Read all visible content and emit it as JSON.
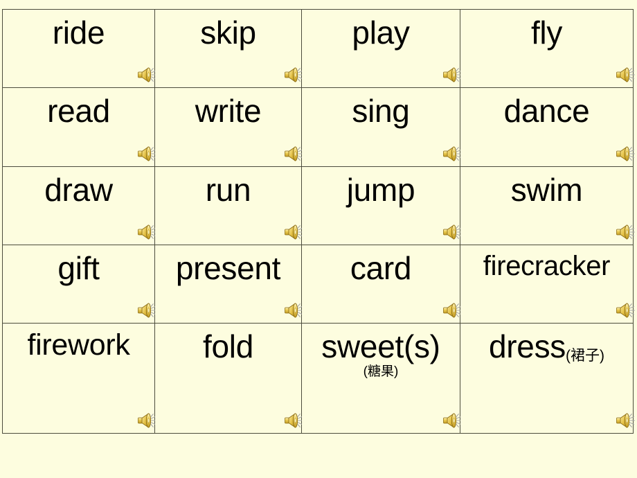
{
  "slide": {
    "background_color": "#fdfddf",
    "border_color": "#4b4b3c",
    "text_color": "#000000",
    "speaker_icon": "speaker-icon",
    "speaker_icon_colors": {
      "body": "#e8c84a",
      "body_light": "#fbeea3",
      "body_dark": "#b9901f",
      "waves": "#b8b8b8"
    }
  },
  "table": {
    "columns": 4,
    "rows": [
      {
        "cells": [
          {
            "word": "ride",
            "gloss_inline": "",
            "gloss_below": "",
            "size": "normal",
            "audio": "speaker-icon"
          },
          {
            "word": "skip",
            "gloss_inline": "",
            "gloss_below": "",
            "size": "normal",
            "audio": "speaker-icon"
          },
          {
            "word": "play",
            "gloss_inline": "",
            "gloss_below": "",
            "size": "normal",
            "audio": "speaker-icon"
          },
          {
            "word": "fly",
            "gloss_inline": "",
            "gloss_below": "",
            "size": "normal",
            "audio": "speaker-icon"
          }
        ]
      },
      {
        "cells": [
          {
            "word": "read",
            "gloss_inline": "",
            "gloss_below": "",
            "size": "normal",
            "audio": "speaker-icon"
          },
          {
            "word": "write",
            "gloss_inline": "",
            "gloss_below": "",
            "size": "normal",
            "audio": "speaker-icon"
          },
          {
            "word": "sing",
            "gloss_inline": "",
            "gloss_below": "",
            "size": "normal",
            "audio": "speaker-icon"
          },
          {
            "word": "dance",
            "gloss_inline": "",
            "gloss_below": "",
            "size": "normal",
            "audio": "speaker-icon"
          }
        ]
      },
      {
        "cells": [
          {
            "word": "draw",
            "gloss_inline": "",
            "gloss_below": "",
            "size": "normal",
            "audio": "speaker-icon"
          },
          {
            "word": "run",
            "gloss_inline": "",
            "gloss_below": "",
            "size": "normal",
            "audio": "speaker-icon"
          },
          {
            "word": "jump",
            "gloss_inline": "",
            "gloss_below": "",
            "size": "normal",
            "audio": "speaker-icon"
          },
          {
            "word": "swim",
            "gloss_inline": "",
            "gloss_below": "",
            "size": "normal",
            "audio": "speaker-icon"
          }
        ]
      },
      {
        "cells": [
          {
            "word": "gift",
            "gloss_inline": "",
            "gloss_below": "",
            "size": "normal",
            "audio": "speaker-icon"
          },
          {
            "word": "present",
            "gloss_inline": "",
            "gloss_below": "",
            "size": "normal",
            "audio": "speaker-icon"
          },
          {
            "word": "card",
            "gloss_inline": "",
            "gloss_below": "",
            "size": "normal",
            "audio": "speaker-icon"
          },
          {
            "word": "firecracker",
            "gloss_inline": "",
            "gloss_below": "",
            "size": "xs",
            "audio": "speaker-icon"
          }
        ]
      },
      {
        "cells": [
          {
            "word": "firework",
            "gloss_inline": "",
            "gloss_below": "",
            "size": "sm",
            "audio": "speaker-icon"
          },
          {
            "word": "fold",
            "gloss_inline": "",
            "gloss_below": "",
            "size": "normal",
            "audio": "speaker-icon"
          },
          {
            "word": "sweet(s)",
            "gloss_inline": "",
            "gloss_below": "(糖果)",
            "size": "normal",
            "audio": "speaker-icon"
          },
          {
            "word": "dress",
            "gloss_inline": "(裙子)",
            "gloss_below": "",
            "size": "normal",
            "audio": "speaker-icon"
          }
        ]
      }
    ]
  }
}
